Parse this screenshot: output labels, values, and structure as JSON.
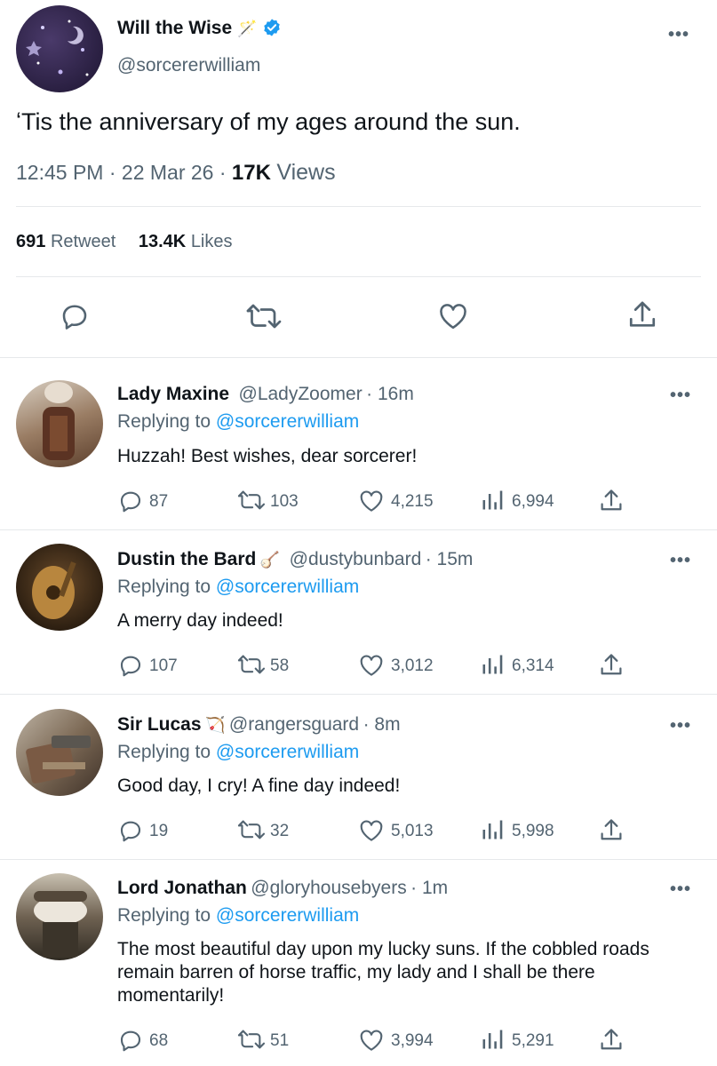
{
  "tweet": {
    "author_name": "Will the Wise",
    "author_emoji": "🪄",
    "author_handle": "@sorcererwilliam",
    "text": "ʻTis the anniversary of my ages around the sun.",
    "time": "12:45 PM",
    "separator": "·",
    "date": "22 Mar 26",
    "views_count": "17K",
    "views_label": "Views",
    "retweet_count": "691",
    "retweet_label": "Retweet",
    "likes_count": "13.4K",
    "likes_label": "Likes",
    "more": "•••"
  },
  "replying_prefix": "Replying to",
  "replies": [
    {
      "name": "Lady Maxine",
      "emoji": "",
      "handle": "@LadyZoomer",
      "age": "· 16m",
      "replying_to": "@sorcererwilliam",
      "text": "Huzzah! Best wishes, dear sorcerer!",
      "replies": "87",
      "retweets": "103",
      "likes": "4,215",
      "views": "6,994"
    },
    {
      "name": "Dustin the Bard",
      "emoji": "🪕",
      "handle": "@dustybunbard",
      "age": "· 15m",
      "replying_to": "@sorcererwilliam",
      "text": "A merry day indeed!",
      "replies": "107",
      "retweets": "58",
      "likes": "3,012",
      "views": "6,314"
    },
    {
      "name": "Sir Lucas",
      "emoji": "🏹",
      "handle": "@rangersguard",
      "age": "· 8m",
      "replying_to": "@sorcererwilliam",
      "text": "Good day, I cry! A fine day indeed!",
      "replies": "19",
      "retweets": "32",
      "likes": "5,013",
      "views": "5,998"
    },
    {
      "name": "Lord Jonathan",
      "emoji": "",
      "handle": "@gloryhousebyers",
      "age": "· 1m",
      "replying_to": "@sorcererwilliam",
      "text": "The most beautiful day upon my lucky suns. If the cobbled roads remain barren of horse traffic, my lady and I shall be there momentarily!",
      "replies": "68",
      "retweets": "51",
      "likes": "3,994",
      "views": "5,291"
    }
  ],
  "colors": {
    "link": "#1d9bf0",
    "muted": "#536471",
    "verified": "#1d9bf0",
    "divider": "#e6e9eb"
  },
  "icons": [
    "verified-badge-icon",
    "more-icon",
    "reply-icon",
    "retweet-icon",
    "like-icon",
    "share-icon",
    "views-icon"
  ]
}
